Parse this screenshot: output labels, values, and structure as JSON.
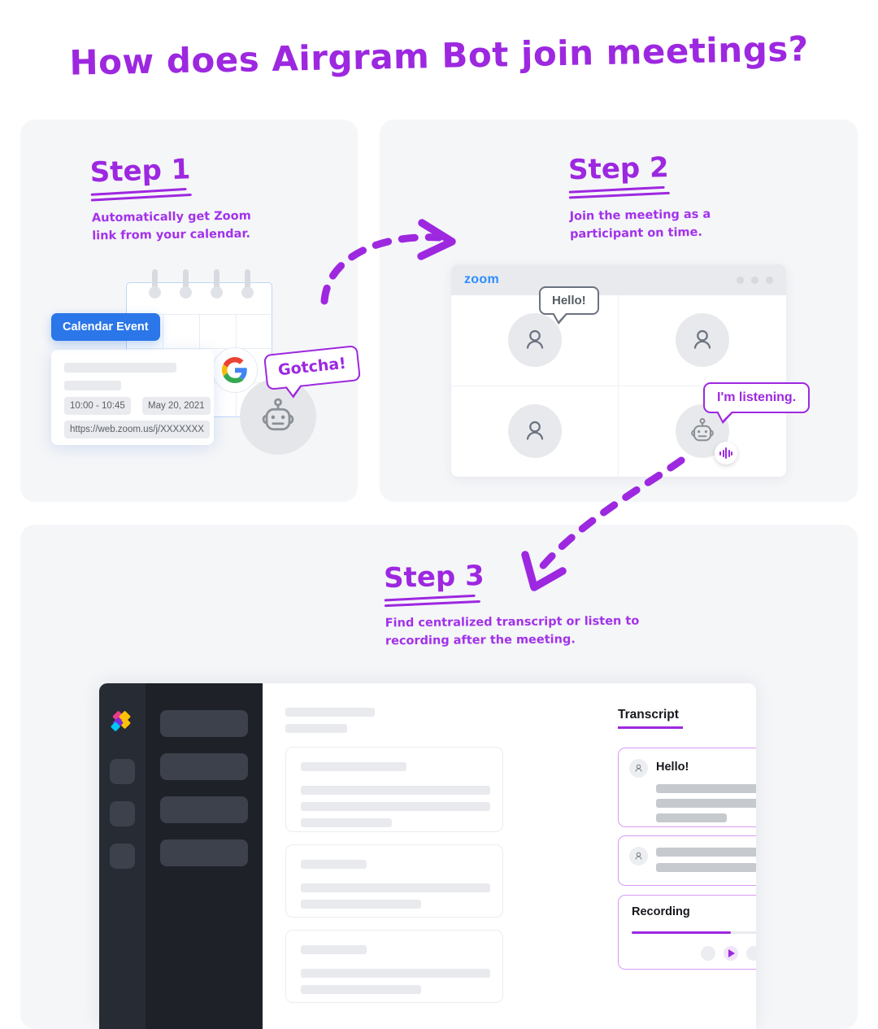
{
  "page": {
    "title": "How does Airgram Bot join meetings?",
    "accent_purple": "#9d28e0",
    "panel_bg": "#f5f6f8",
    "background": "#ffffff"
  },
  "steps": [
    {
      "id": "step-1",
      "title": "Step 1",
      "description": "Automatically get Zoom\nlink from your calendar."
    },
    {
      "id": "step-2",
      "title": "Step 2",
      "description": "Join the meeting as a\nparticipant on time."
    },
    {
      "id": "step-3",
      "title": "Step 3",
      "description": "Find centralized transcript or listen to\nrecording after the meeting."
    }
  ],
  "step1": {
    "badge_label": "Calendar Event",
    "badge_color": "#2b76e8",
    "event": {
      "time": "10:00 - 10:45",
      "date": "May 20, 2021",
      "link": "https://web.zoom.us/j/XXXXXXX"
    },
    "google_icon": "google-g-logo",
    "robot_icon": "robot-avatar-icon",
    "bubble_text": "Gotcha!"
  },
  "step2": {
    "window_brand": "zoom",
    "brand_color": "#2d8cff",
    "window_dots": 3,
    "tiles": [
      {
        "icon": "person-avatar-icon",
        "bubble": "Hello!",
        "bubble_color": "#6b7280"
      },
      {
        "icon": "person-avatar-icon",
        "bubble": null,
        "bubble_color": null
      },
      {
        "icon": "person-avatar-icon",
        "bubble": null,
        "bubble_color": null
      },
      {
        "icon": "robot-avatar-icon",
        "bubble": "I'm listening.",
        "bubble_color": "#9d28e0"
      }
    ],
    "listening_badge_icon": "audio-waveform-icon"
  },
  "step3": {
    "app": {
      "logo_icon": "airgram-diamond-logo",
      "logo_colors": [
        "#ec3a8e",
        "#ffc107",
        "#00c4f5",
        "#7b2bd9"
      ],
      "rail_icons": [
        "rail-icon-1",
        "rail-icon-2",
        "rail-icon-3"
      ],
      "nav_items": [
        "nav-item-1",
        "nav-item-2",
        "nav-item-3",
        "nav-item-4"
      ],
      "transcript": {
        "heading": "Transcript",
        "entries": [
          {
            "speaker_icon": "person-icon",
            "label": "Hello!",
            "lines": [
              100,
              100,
              46
            ]
          },
          {
            "speaker_icon": "person-icon",
            "label": "",
            "lines": [
              100,
              62
            ]
          }
        ]
      },
      "recording": {
        "label": "Recording",
        "progress_percent": 50,
        "controls": [
          "previous-button",
          "play-button",
          "next-button"
        ],
        "play_icon": "play-triangle-icon"
      }
    }
  },
  "arrows": [
    {
      "name": "arrow-step1-to-step2",
      "direction": "right"
    },
    {
      "name": "arrow-step2-to-step3",
      "direction": "down-left"
    }
  ]
}
